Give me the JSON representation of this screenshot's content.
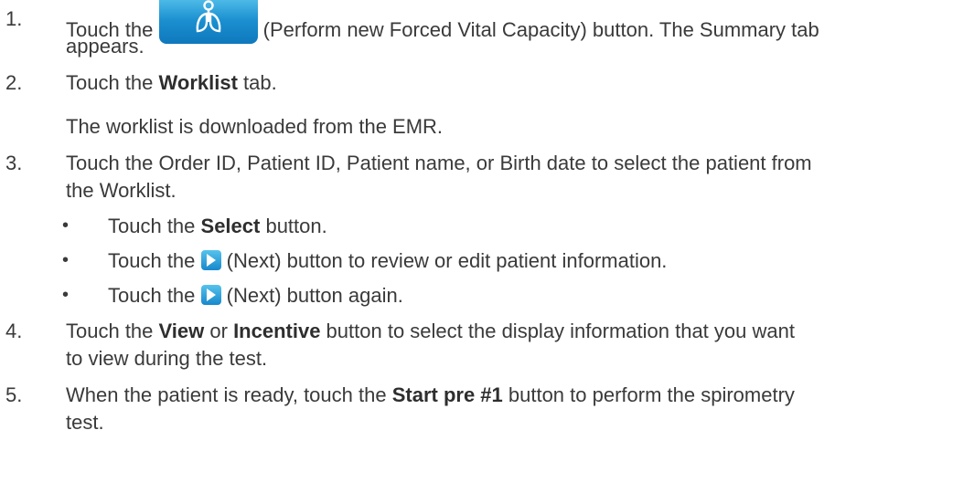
{
  "steps": {
    "s1": {
      "num": "1.",
      "pre": "Touch the",
      "post": " (Perform new Forced Vital Capacity) button. The Summary tab",
      "line2": "appears."
    },
    "s2": {
      "num": "2.",
      "pre": "Touch the ",
      "bold": "Worklist",
      "post": " tab.",
      "note": "The worklist is downloaded from the EMR."
    },
    "s3": {
      "num": "3.",
      "line1": "Touch the Order ID, Patient ID, Patient name, or Birth date to select the patient from",
      "line2": "the Worklist."
    },
    "s3b": [
      {
        "pre": "Touch the ",
        "bold": "Select",
        "post": " button."
      },
      {
        "pre": "Touch the ",
        "post": " (Next) button to review or edit patient information."
      },
      {
        "pre": "Touch the ",
        "post": " (Next) button again."
      }
    ],
    "s4": {
      "num": "4.",
      "pre": "Touch the ",
      "bold1": "View",
      "mid": " or ",
      "bold2": "Incentive",
      "post": " button to select the display information that you want",
      "line2": "to view during the test."
    },
    "s5": {
      "num": "5.",
      "pre": "When the patient is ready, touch the ",
      "bold": "Start pre #1",
      "post": " button to perform the spirometry",
      "line2": "test."
    }
  },
  "bullet_glyph": "•",
  "icons": {
    "fvc_button": "lungs-icon",
    "next_button": "next-arrow-icon"
  }
}
